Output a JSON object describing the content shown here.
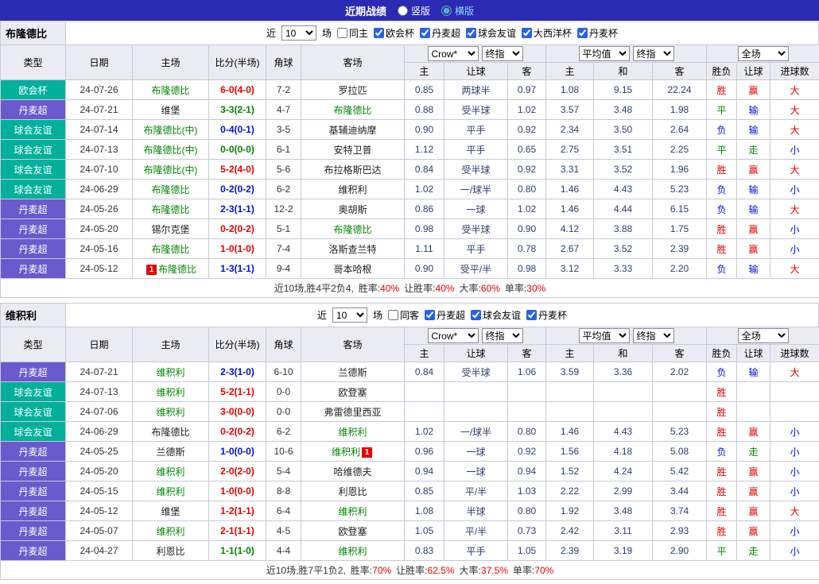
{
  "topbar": {
    "title": "近期战绩",
    "options": [
      {
        "label": "竖版",
        "selected": false
      },
      {
        "label": "横版",
        "selected": true
      }
    ]
  },
  "colors": {
    "topbar_bg": "#2a2ab2",
    "league_teal": "#00b09b",
    "league_purple": "#6a5acd",
    "focal_team_green": "#008800",
    "win_red": "#e60000",
    "lose_blue": "#0011dd",
    "draw_green": "#008800"
  },
  "header": {
    "static_cols": [
      "类型",
      "日期",
      "主场",
      "比分(半场)",
      "角球",
      "客场"
    ],
    "group1": {
      "select1": "Crow*",
      "select2": "终指",
      "subcols": [
        "主",
        "让球",
        "客"
      ]
    },
    "group2": {
      "select1": "平均值",
      "select2": "终指",
      "subcols": [
        "主",
        "和",
        "客"
      ]
    },
    "group3": {
      "select1": "全场",
      "subcols": [
        "胜负",
        "让球",
        "进球数"
      ]
    }
  },
  "sections": [
    {
      "team": "布隆德比",
      "filter": {
        "near": "近",
        "count": "10",
        "games": "场",
        "same": {
          "label": "同主",
          "checked": false
        },
        "leagues": [
          {
            "label": "欧会杯",
            "checked": true
          },
          {
            "label": "丹麦超",
            "checked": true
          },
          {
            "label": "球会友谊",
            "checked": true
          },
          {
            "label": "大西洋杯",
            "checked": true
          },
          {
            "label": "丹麦杯",
            "checked": true
          }
        ]
      },
      "rows": [
        {
          "league": "欧会杯",
          "league_color": "teal",
          "date": "24-07-26",
          "home": "布隆德比",
          "home_focal": true,
          "home_badge": "",
          "score": "6-0(4-0)",
          "score_result": "win",
          "corner": "7-2",
          "away": "罗拉匹",
          "away_focal": false,
          "away_badge": "",
          "odds": [
            "0.85",
            "两球半",
            "0.97",
            "1.08",
            "9.15",
            "22.24"
          ],
          "results": [
            [
              "胜",
              "win"
            ],
            [
              "赢",
              "win"
            ],
            [
              "大",
              "win"
            ]
          ]
        },
        {
          "league": "丹麦超",
          "league_color": "purple",
          "date": "24-07-21",
          "home": "维堡",
          "home_focal": false,
          "home_badge": "",
          "score": "3-3(2-1)",
          "score_result": "draw",
          "corner": "4-7",
          "away": "布隆德比",
          "away_focal": true,
          "away_badge": "",
          "odds": [
            "0.88",
            "受半球",
            "1.02",
            "3.57",
            "3.48",
            "1.98"
          ],
          "results": [
            [
              "平",
              "draw"
            ],
            [
              "输",
              "lose"
            ],
            [
              "大",
              "win"
            ]
          ]
        },
        {
          "league": "球会友谊",
          "league_color": "teal",
          "date": "24-07-14",
          "home": "布隆德比(中)",
          "home_focal": true,
          "home_badge": "",
          "score": "0-4(0-1)",
          "score_result": "lose",
          "corner": "3-5",
          "away": "基辅迪纳摩",
          "away_focal": false,
          "away_badge": "",
          "odds": [
            "0.90",
            "平手",
            "0.92",
            "2.34",
            "3.50",
            "2.64"
          ],
          "results": [
            [
              "负",
              "lose"
            ],
            [
              "输",
              "lose"
            ],
            [
              "大",
              "win"
            ]
          ]
        },
        {
          "league": "球会友谊",
          "league_color": "teal",
          "date": "24-07-13",
          "home": "布隆德比(中)",
          "home_focal": true,
          "home_badge": "",
          "score": "0-0(0-0)",
          "score_result": "draw",
          "corner": "6-1",
          "away": "安特卫普",
          "away_focal": false,
          "away_badge": "",
          "odds": [
            "1.12",
            "平手",
            "0.65",
            "2.75",
            "3.51",
            "2.25"
          ],
          "results": [
            [
              "平",
              "draw"
            ],
            [
              "走",
              "draw"
            ],
            [
              "小",
              "lose"
            ]
          ]
        },
        {
          "league": "球会友谊",
          "league_color": "teal",
          "date": "24-07-10",
          "home": "布隆德比(中)",
          "home_focal": true,
          "home_badge": "",
          "score": "5-2(4-0)",
          "score_result": "win",
          "corner": "5-6",
          "away": "布拉格斯巴达",
          "away_focal": false,
          "away_badge": "",
          "odds": [
            "0.84",
            "受半球",
            "0.92",
            "3.31",
            "3.52",
            "1.96"
          ],
          "results": [
            [
              "胜",
              "win"
            ],
            [
              "赢",
              "win"
            ],
            [
              "大",
              "win"
            ]
          ]
        },
        {
          "league": "球会友谊",
          "league_color": "teal",
          "date": "24-06-29",
          "home": "布隆德比",
          "home_focal": true,
          "home_badge": "",
          "score": "0-2(0-2)",
          "score_result": "lose",
          "corner": "6-2",
          "away": "维积利",
          "away_focal": false,
          "away_badge": "",
          "odds": [
            "1.02",
            "一/球半",
            "0.80",
            "1.46",
            "4.43",
            "5.23"
          ],
          "results": [
            [
              "负",
              "lose"
            ],
            [
              "输",
              "lose"
            ],
            [
              "小",
              "lose"
            ]
          ]
        },
        {
          "league": "丹麦超",
          "league_color": "purple",
          "date": "24-05-26",
          "home": "布隆德比",
          "home_focal": true,
          "home_badge": "",
          "score": "2-3(1-1)",
          "score_result": "lose",
          "corner": "12-2",
          "away": "奥胡斯",
          "away_focal": false,
          "away_badge": "",
          "odds": [
            "0.86",
            "一球",
            "1.02",
            "1.46",
            "4.44",
            "6.15"
          ],
          "results": [
            [
              "负",
              "lose"
            ],
            [
              "输",
              "lose"
            ],
            [
              "大",
              "win"
            ]
          ]
        },
        {
          "league": "丹麦超",
          "league_color": "purple",
          "date": "24-05-20",
          "home": "锡尔克堡",
          "home_focal": false,
          "home_badge": "",
          "score": "0-2(0-2)",
          "score_result": "win",
          "corner": "5-1",
          "away": "布隆德比",
          "away_focal": true,
          "away_badge": "",
          "odds": [
            "0.98",
            "受半球",
            "0.90",
            "4.12",
            "3.88",
            "1.75"
          ],
          "results": [
            [
              "胜",
              "win"
            ],
            [
              "赢",
              "win"
            ],
            [
              "小",
              "lose"
            ]
          ]
        },
        {
          "league": "丹麦超",
          "league_color": "purple",
          "date": "24-05-16",
          "home": "布隆德比",
          "home_focal": true,
          "home_badge": "",
          "score": "1-0(1-0)",
          "score_result": "win",
          "corner": "7-4",
          "away": "洛斯查兰特",
          "away_focal": false,
          "away_badge": "",
          "odds": [
            "1.11",
            "平手",
            "0.78",
            "2.67",
            "3.52",
            "2.39"
          ],
          "results": [
            [
              "胜",
              "win"
            ],
            [
              "赢",
              "win"
            ],
            [
              "小",
              "lose"
            ]
          ]
        },
        {
          "league": "丹麦超",
          "league_color": "purple",
          "date": "24-05-12",
          "home": "布隆德比",
          "home_focal": true,
          "home_badge": "1",
          "score": "1-3(1-1)",
          "score_result": "lose",
          "corner": "9-4",
          "away": "哥本哈根",
          "away_focal": false,
          "away_badge": "",
          "odds": [
            "0.90",
            "受平/半",
            "0.98",
            "3.12",
            "3.33",
            "2.20"
          ],
          "results": [
            [
              "负",
              "lose"
            ],
            [
              "输",
              "lose"
            ],
            [
              "大",
              "win"
            ]
          ]
        }
      ],
      "footer": {
        "summary": "近10场,胜4平2负4,",
        "stats": [
          {
            "label": "胜率:",
            "value": "40%"
          },
          {
            "label": "让胜率:",
            "value": "40%"
          },
          {
            "label": "大率:",
            "value": "60%"
          },
          {
            "label": "单率:",
            "value": "30%"
          }
        ]
      }
    },
    {
      "team": "维积利",
      "filter": {
        "near": "近",
        "count": "10",
        "games": "场",
        "same": {
          "label": "同客",
          "checked": false
        },
        "leagues": [
          {
            "label": "丹麦超",
            "checked": true
          },
          {
            "label": "球会友谊",
            "checked": true
          },
          {
            "label": "丹麦杯",
            "checked": true
          }
        ]
      },
      "rows": [
        {
          "league": "丹麦超",
          "league_color": "purple",
          "date": "24-07-21",
          "home": "维积利",
          "home_focal": true,
          "home_badge": "",
          "score": "2-3(1-0)",
          "score_result": "lose",
          "corner": "6-10",
          "away": "兰德斯",
          "away_focal": false,
          "away_badge": "",
          "odds": [
            "0.84",
            "受半球",
            "1.06",
            "3.59",
            "3.36",
            "2.02"
          ],
          "results": [
            [
              "负",
              "lose"
            ],
            [
              "输",
              "lose"
            ],
            [
              "大",
              "win"
            ]
          ]
        },
        {
          "league": "球会友谊",
          "league_color": "teal",
          "date": "24-07-13",
          "home": "维积利",
          "home_focal": true,
          "home_badge": "",
          "score": "5-2(1-1)",
          "score_result": "win",
          "corner": "0-0",
          "away": "欧登塞",
          "away_focal": false,
          "away_badge": "",
          "odds": [
            "",
            "",
            "",
            "",
            "",
            ""
          ],
          "results": [
            [
              "胜",
              "win"
            ],
            [
              "",
              ""
            ],
            [
              "",
              ""
            ]
          ]
        },
        {
          "league": "球会友谊",
          "league_color": "teal",
          "date": "24-07-06",
          "home": "维积利",
          "home_focal": true,
          "home_badge": "",
          "score": "3-0(0-0)",
          "score_result": "win",
          "corner": "0-0",
          "away": "弗雷德里西亚",
          "away_focal": false,
          "away_badge": "",
          "odds": [
            "",
            "",
            "",
            "",
            "",
            ""
          ],
          "results": [
            [
              "胜",
              "win"
            ],
            [
              "",
              ""
            ],
            [
              "",
              ""
            ]
          ]
        },
        {
          "league": "球会友谊",
          "league_color": "teal",
          "date": "24-06-29",
          "home": "布隆德比",
          "home_focal": false,
          "home_badge": "",
          "score": "0-2(0-2)",
          "score_result": "win",
          "corner": "6-2",
          "away": "维积利",
          "away_focal": true,
          "away_badge": "",
          "odds": [
            "1.02",
            "一/球半",
            "0.80",
            "1.46",
            "4.43",
            "5.23"
          ],
          "results": [
            [
              "胜",
              "win"
            ],
            [
              "赢",
              "win"
            ],
            [
              "小",
              "lose"
            ]
          ]
        },
        {
          "league": "丹麦超",
          "league_color": "purple",
          "date": "24-05-25",
          "home": "兰德斯",
          "home_focal": false,
          "home_badge": "",
          "score": "1-0(0-0)",
          "score_result": "lose",
          "corner": "10-6",
          "away": "维积利",
          "away_focal": true,
          "away_badge": "1",
          "odds": [
            "0.96",
            "一球",
            "0.92",
            "1.56",
            "4.18",
            "5.08"
          ],
          "results": [
            [
              "负",
              "lose"
            ],
            [
              "走",
              "draw"
            ],
            [
              "小",
              "lose"
            ]
          ]
        },
        {
          "league": "丹麦超",
          "league_color": "purple",
          "date": "24-05-20",
          "home": "维积利",
          "home_focal": true,
          "home_badge": "",
          "score": "2-0(2-0)",
          "score_result": "win",
          "corner": "5-4",
          "away": "哈维德夫",
          "away_focal": false,
          "away_badge": "",
          "odds": [
            "0.94",
            "一球",
            "0.94",
            "1.52",
            "4.24",
            "5.42"
          ],
          "results": [
            [
              "胜",
              "win"
            ],
            [
              "赢",
              "win"
            ],
            [
              "小",
              "lose"
            ]
          ]
        },
        {
          "league": "丹麦超",
          "league_color": "purple",
          "date": "24-05-15",
          "home": "维积利",
          "home_focal": true,
          "home_badge": "",
          "score": "1-0(0-0)",
          "score_result": "win",
          "corner": "8-8",
          "away": "利恩比",
          "away_focal": false,
          "away_badge": "",
          "odds": [
            "0.85",
            "平/半",
            "1.03",
            "2.22",
            "2.99",
            "3.44"
          ],
          "results": [
            [
              "胜",
              "win"
            ],
            [
              "赢",
              "win"
            ],
            [
              "小",
              "lose"
            ]
          ]
        },
        {
          "league": "丹麦超",
          "league_color": "purple",
          "date": "24-05-12",
          "home": "维堡",
          "home_focal": false,
          "home_badge": "",
          "score": "1-2(1-1)",
          "score_result": "win",
          "corner": "6-4",
          "away": "维积利",
          "away_focal": true,
          "away_badge": "",
          "odds": [
            "1.08",
            "半球",
            "0.80",
            "1.92",
            "3.48",
            "3.74"
          ],
          "results": [
            [
              "胜",
              "win"
            ],
            [
              "赢",
              "win"
            ],
            [
              "大",
              "win"
            ]
          ]
        },
        {
          "league": "丹麦超",
          "league_color": "purple",
          "date": "24-05-07",
          "home": "维积利",
          "home_focal": true,
          "home_badge": "",
          "score": "2-1(1-1)",
          "score_result": "win",
          "corner": "4-5",
          "away": "欧登塞",
          "away_focal": false,
          "away_badge": "",
          "odds": [
            "1.05",
            "平/半",
            "0.73",
            "2.42",
            "3.11",
            "2.93"
          ],
          "results": [
            [
              "胜",
              "win"
            ],
            [
              "赢",
              "win"
            ],
            [
              "小",
              "lose"
            ]
          ]
        },
        {
          "league": "丹麦超",
          "league_color": "purple",
          "date": "24-04-27",
          "home": "利恩比",
          "home_focal": false,
          "home_badge": "",
          "score": "1-1(1-0)",
          "score_result": "draw",
          "corner": "4-4",
          "away": "维积利",
          "away_focal": true,
          "away_badge": "",
          "odds": [
            "0.83",
            "平手",
            "1.05",
            "2.39",
            "3.19",
            "2.90"
          ],
          "results": [
            [
              "平",
              "draw"
            ],
            [
              "走",
              "draw"
            ],
            [
              "小",
              "lose"
            ]
          ]
        }
      ],
      "footer": {
        "summary": "近10场,胜7平1负2,",
        "stats": [
          {
            "label": "胜率:",
            "value": "70%"
          },
          {
            "label": "让胜率:",
            "value": "62.5%"
          },
          {
            "label": "大率:",
            "value": "37.5%"
          },
          {
            "label": "单率:",
            "value": "70%"
          }
        ]
      }
    }
  ]
}
